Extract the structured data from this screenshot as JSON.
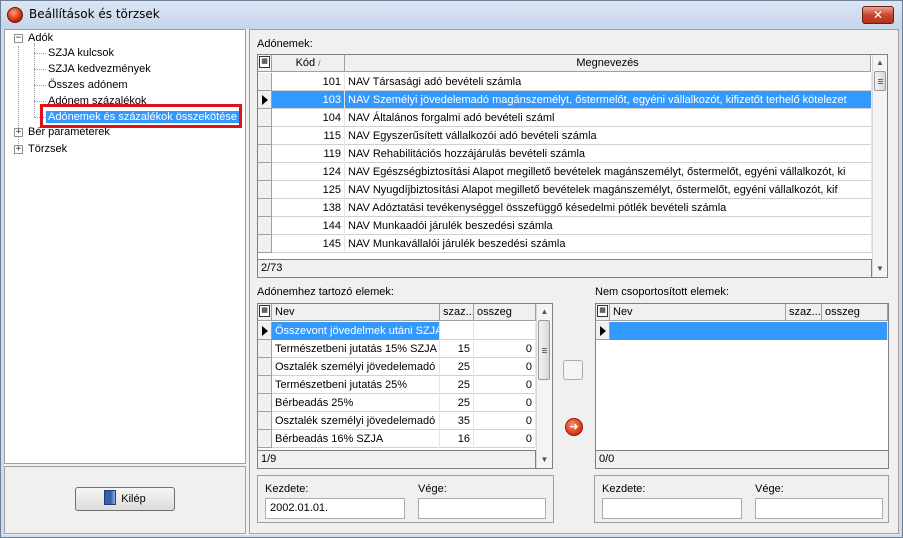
{
  "window": {
    "title": "Beállítások és törzsek",
    "close_symbol": "✕"
  },
  "tree": {
    "root_ado": "Adók",
    "children": [
      "SZJA kulcsok",
      "SZJA kedvezmények",
      "Összes adónem",
      "Adónem százalékok",
      "Adónemek és százalékok összekötése"
    ],
    "ber": "Bér paraméterek",
    "torzsek": "Törzsek"
  },
  "exit_button": {
    "label": "Kilép",
    "icon": "door-exit-icon"
  },
  "adonemek": {
    "label": "Adónemek:",
    "columns": {
      "kod": "Kód",
      "sort": "/",
      "megnevezes": "Megnevezés"
    },
    "rows": [
      {
        "kod": "101",
        "nev": "NAV Társasági adó bevételi számla"
      },
      {
        "kod": "103",
        "nev": "NAV Személyi jövedelemadó magánszemélyt, őstermelőt, egyéni vállalkozót, kifizetőt terhelő kötelezet"
      },
      {
        "kod": "104",
        "nev": "NAV Általános forgalmi adó bevételi száml"
      },
      {
        "kod": "115",
        "nev": "NAV Egyszerűsített vállalkozói adó bevételi számla"
      },
      {
        "kod": "119",
        "nev": "NAV Rehabilitációs hozzájárulás bevételi számla"
      },
      {
        "kod": "124",
        "nev": "NAV Egészségbiztosítási Alapot megillető bevételek magánszemélyt, őstermelőt, egyéni vállalkozót, ki"
      },
      {
        "kod": "125",
        "nev": "NAV Nyugdíjbiztosítási Alapot megillető bevételek magánszemélyt, őstermelőt, egyéni vállalkozót, kif"
      },
      {
        "kod": "138",
        "nev": "NAV Adóztatási tevékenységgel összefüggő késedelmi pótlék bevételi számla"
      },
      {
        "kod": "144",
        "nev": "NAV Munkaadói járulék beszedési számla"
      },
      {
        "kod": "145",
        "nev": "NAV Munkavállalói járulék beszedési számla"
      }
    ],
    "status": "2/73"
  },
  "tartozo": {
    "label": "Adónemhez tartozó elemek:",
    "columns": {
      "nev": "Nev",
      "szaz": "szaz...",
      "osszeg": "osszeg"
    },
    "rows": [
      {
        "nev": "Összevont jövedelmek utáni SZJA",
        "szaz": "",
        "osszeg": ""
      },
      {
        "nev": "Természetbeni jutatás 15% SZJA",
        "szaz": "15",
        "osszeg": "0"
      },
      {
        "nev": "Osztalék személyi jövedelemadó ...",
        "szaz": "25",
        "osszeg": "0"
      },
      {
        "nev": "Természetbeni jutatás 25%",
        "szaz": "25",
        "osszeg": "0"
      },
      {
        "nev": "Bérbeadás 25%",
        "szaz": "25",
        "osszeg": "0"
      },
      {
        "nev": "Osztalék személyi jövedelemadó ...",
        "szaz": "35",
        "osszeg": "0"
      },
      {
        "nev": "Bérbeadás 16% SZJA",
        "szaz": "16",
        "osszeg": "0"
      }
    ],
    "status": "1/9",
    "kezdete_label": "Kezdete:",
    "kezdete_value": "2002.01.01.",
    "vege_label": "Vége:",
    "vege_value": ""
  },
  "nem_csop": {
    "label": "Nem csoportosított elemek:",
    "columns": {
      "nev": "Nev",
      "szaz": "szaz...",
      "osszeg": "osszeg"
    },
    "status": "0/0",
    "kezdete_label": "Kezdete:",
    "kezdete_value": "",
    "vege_label": "Vége:",
    "vege_value": ""
  },
  "move_button": {
    "symbol": "➔"
  },
  "accent": {
    "selection": "#3399ff",
    "highlight_frame": "#e0101a"
  }
}
